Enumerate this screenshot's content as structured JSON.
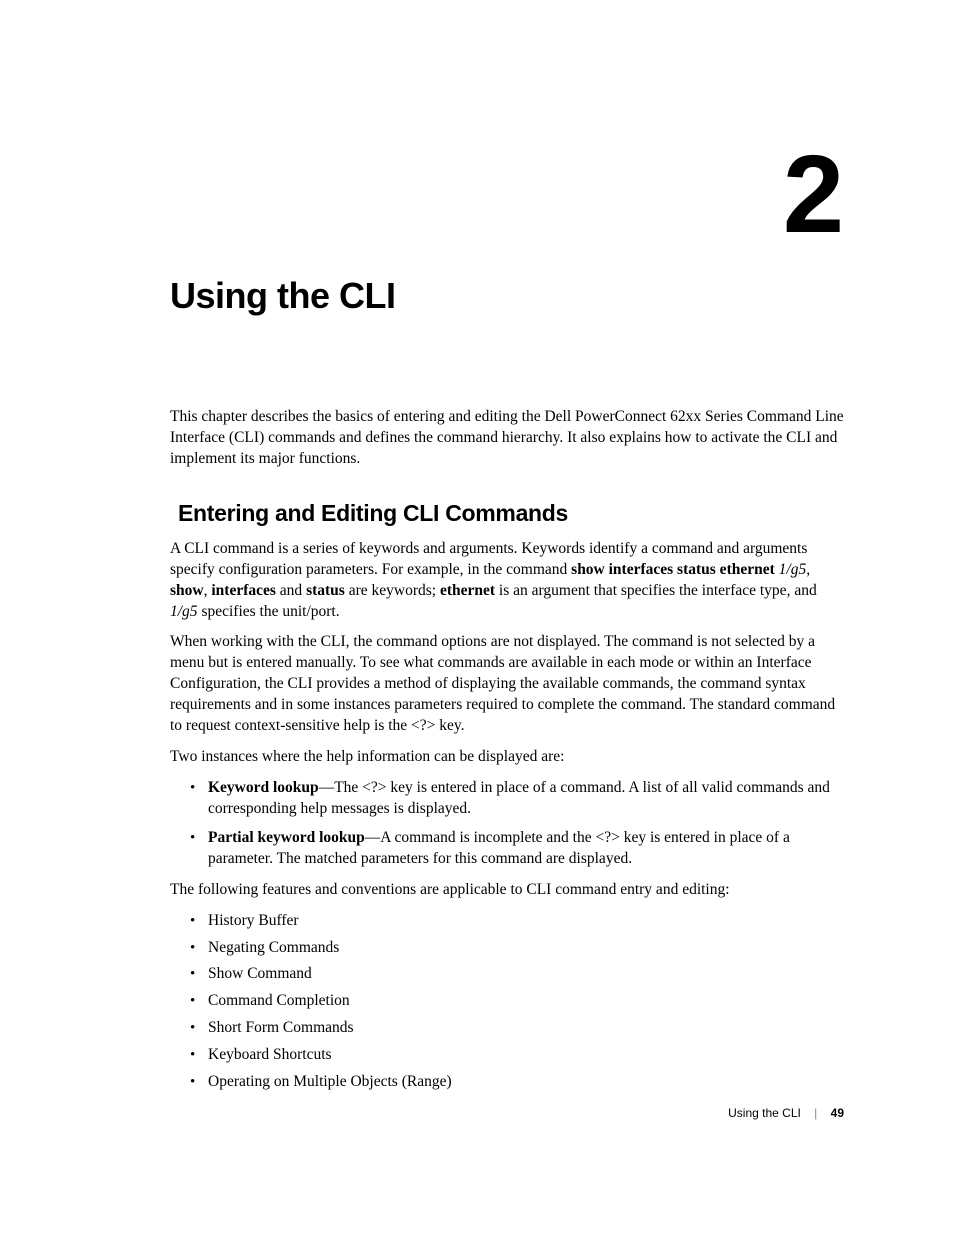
{
  "chapter_number": "2",
  "chapter_title": "Using the CLI",
  "intro": "This chapter describes the basics of entering and editing the Dell PowerConnect 62xx Series Command Line Interface (CLI) commands and defines the command hierarchy. It also explains how to activate the CLI and implement its major functions.",
  "section_heading": "Entering and Editing CLI Commands",
  "p1_a": "A CLI command is a series of keywords and arguments. Keywords identify a command and arguments specify configuration parameters. For example, in the command ",
  "p1_b_bold": "show interfaces status ethernet",
  "p1_c": " ",
  "p1_c_italic": "1/g5",
  "p1_d": ", ",
  "p1_d_bold1": "show",
  "p1_e": ", ",
  "p1_e_bold2": "interfaces",
  "p1_f": " and ",
  "p1_f_bold3": "status",
  "p1_g": " are keywords; ",
  "p1_g_bold4": "ethernet",
  "p1_h": " is an argument that specifies the interface type, and ",
  "p1_h_italic": "1/g5",
  "p1_i": " specifies the unit/port.",
  "p2": "When working with the CLI, the command options are not displayed. The command is not selected by a menu but is entered manually. To see what commands are available in each mode or within an Interface Configuration, the CLI provides a method of displaying the available commands, the command syntax requirements and in some instances parameters required to complete the command. The standard command to request context-sensitive help is the <?> key.",
  "p3": "Two instances where the help information can be displayed are:",
  "li1_bold": "Keyword lookup",
  "li1_rest": "—The <?> key is entered in place of a command. A list of all valid commands and corresponding help messages is displayed.",
  "li2_bold": "Partial keyword lookup",
  "li2_rest": "—A command is incomplete and the <?> key is entered in place of a parameter. The matched parameters for this command are displayed.",
  "p4": "The following features and conventions are applicable to CLI command entry and editing:",
  "features": [
    "History Buffer",
    "Negating Commands",
    "Show Command",
    "Command Completion",
    "Short Form Commands",
    "Keyboard Shortcuts",
    "Operating on Multiple Objects (Range)"
  ],
  "footer_title": "Using the CLI",
  "footer_sep": "|",
  "footer_page": "49"
}
